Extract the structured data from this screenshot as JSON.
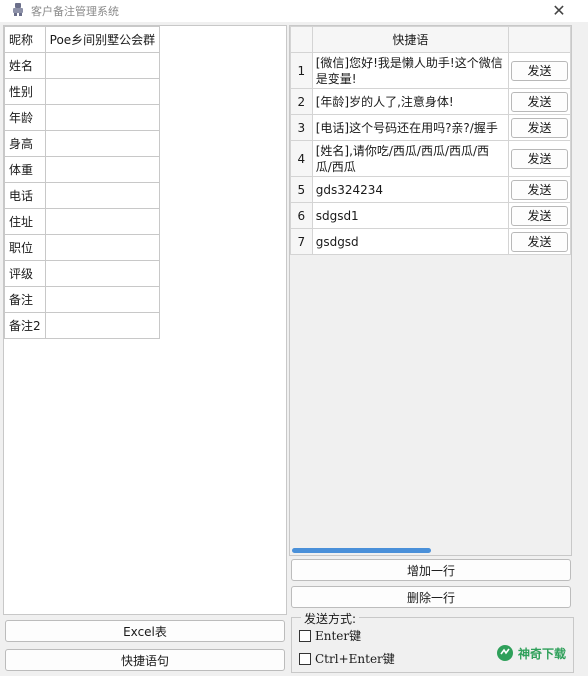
{
  "window": {
    "title": "客户备注管理系统",
    "close_glyph": "✕"
  },
  "profile": {
    "rows": [
      {
        "label": "昵称",
        "value": "Poe乡间别墅公会群"
      },
      {
        "label": "姓名",
        "value": ""
      },
      {
        "label": "性别",
        "value": ""
      },
      {
        "label": "年龄",
        "value": ""
      },
      {
        "label": "身高",
        "value": ""
      },
      {
        "label": "体重",
        "value": ""
      },
      {
        "label": "电话",
        "value": ""
      },
      {
        "label": "住址",
        "value": ""
      },
      {
        "label": "职位",
        "value": ""
      },
      {
        "label": "评级",
        "value": ""
      },
      {
        "label": "备注",
        "value": ""
      },
      {
        "label": "备注2",
        "value": ""
      }
    ]
  },
  "left_buttons": {
    "excel": "Excel表",
    "quick_phrases": "快捷语句"
  },
  "phrases": {
    "header": "快捷语",
    "send_label": "发送",
    "rows": [
      {
        "num": "1",
        "text": "[微信]您好!我是懒人助手!这个微信是变量!"
      },
      {
        "num": "2",
        "text": "[年龄]岁的人了,注意身体!"
      },
      {
        "num": "3",
        "text": "[电话]这个号码还在用吗?亲?/握手"
      },
      {
        "num": "4",
        "text": "[姓名],请你吃/西瓜/西瓜/西瓜/西瓜/西瓜"
      },
      {
        "num": "5",
        "text": "gds324234"
      },
      {
        "num": "6",
        "text": "sdgsd1"
      },
      {
        "num": "7",
        "text": "gsdgsd"
      }
    ]
  },
  "right_buttons": {
    "add_row": "增加一行",
    "delete_row": "删除一行"
  },
  "send_mode": {
    "legend": "发送方式:",
    "options": [
      {
        "label": "Enter键",
        "checked": false
      },
      {
        "label": "Ctrl+Enter键",
        "checked": false
      }
    ]
  },
  "watermark": {
    "text": "神奇下载"
  },
  "colors": {
    "scroll_thumb": "#4a90d9",
    "watermark_green": "#2fa05a"
  }
}
